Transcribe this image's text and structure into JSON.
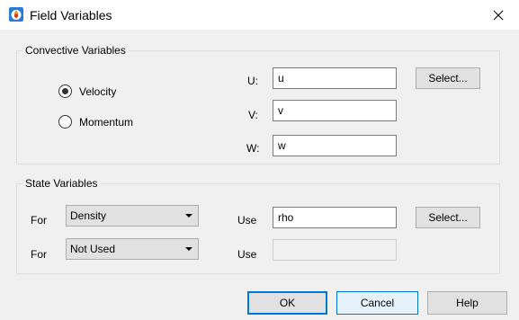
{
  "window": {
    "title": "Field Variables",
    "icons": {
      "app": "app-logo-icon",
      "close": "close-icon"
    }
  },
  "convective": {
    "title": "Convective Variables",
    "radios": [
      {
        "label": "Velocity",
        "checked": true
      },
      {
        "label": "Momentum",
        "checked": false
      }
    ],
    "fields": [
      {
        "label": "U:",
        "value": "u"
      },
      {
        "label": "V:",
        "value": "v"
      },
      {
        "label": "W:",
        "value": "w"
      }
    ],
    "select_label": "Select..."
  },
  "state": {
    "title": "State Variables",
    "rows": [
      {
        "for_label": "For",
        "selected": "Density",
        "use_label": "Use",
        "value": "rho",
        "enabled": true
      },
      {
        "for_label": "For",
        "selected": "Not Used",
        "use_label": "Use",
        "value": "",
        "enabled": false
      }
    ],
    "select_label": "Select..."
  },
  "buttons": {
    "ok": "OK",
    "cancel": "Cancel",
    "help": "Help"
  }
}
